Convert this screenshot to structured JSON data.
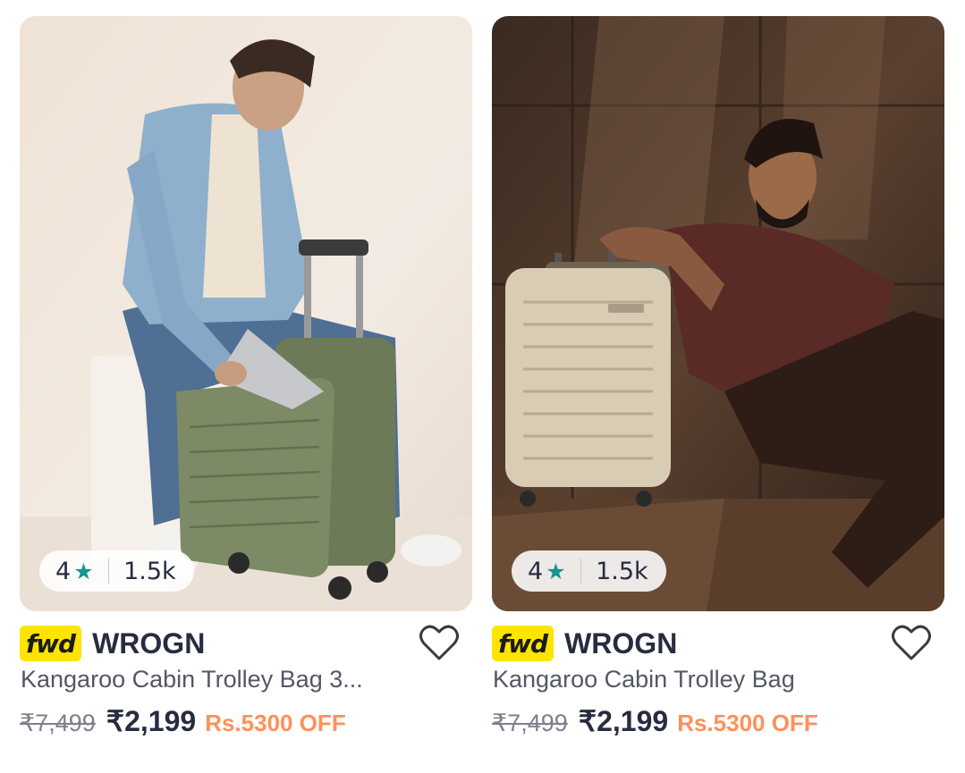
{
  "products": [
    {
      "image_alt": "Man in denim jacket placing laptop in olive green cabin trolley bag",
      "rating": "4",
      "rating_star": "★",
      "rating_count": "1.5k",
      "badge": "fwd",
      "brand": "WROGN",
      "title": "Kangaroo Cabin Trolley Bag 3...",
      "mrp": "₹7,499",
      "price": "₹2,199",
      "discount": "Rs.5300 OFF",
      "wishlist_icon": "heart-outline-icon"
    },
    {
      "image_alt": "Man in maroon shirt seated beside beige cabin trolley bag",
      "rating": "4",
      "rating_star": "★",
      "rating_count": "1.5k",
      "badge": "fwd",
      "brand": "WROGN",
      "title": "Kangaroo Cabin Trolley Bag",
      "mrp": "₹7,499",
      "price": "₹2,199",
      "discount": "Rs.5300 OFF",
      "wishlist_icon": "heart-outline-icon"
    }
  ],
  "colors": {
    "badge_yellow": "#ffe400",
    "rating_star": "#14958f",
    "discount": "#ff905a",
    "text_dark": "#282c3f",
    "text_muted": "#535766"
  }
}
